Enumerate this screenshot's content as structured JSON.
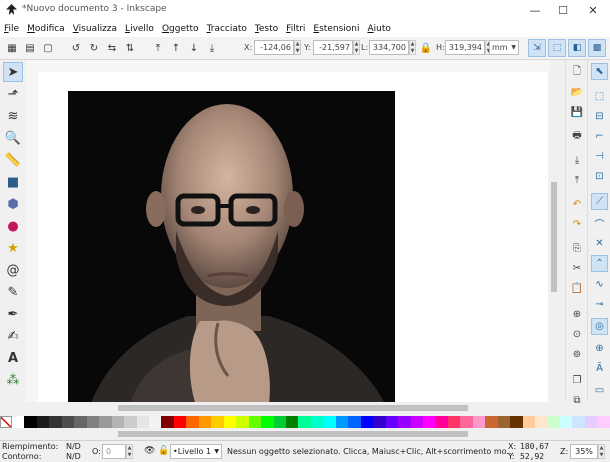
{
  "window": {
    "title": "*Nuovo documento 3 - Inkscape",
    "minimize": "—",
    "maximize": "☐",
    "close": "✕"
  },
  "menu": [
    "File",
    "Modifica",
    "Visualizza",
    "Livello",
    "Oggetto",
    "Tracciato",
    "Testo",
    "Filtri",
    "Estensioni",
    "Aiuto"
  ],
  "toolbar": {
    "x_label": "X:",
    "x_value": "-124,06",
    "y_label": "Y:",
    "y_value": "-21,597",
    "w_label": "L:",
    "w_value": "334,700",
    "h_label": "H:",
    "h_value": "319,394",
    "unit": "mm"
  },
  "status": {
    "fill_label": "Riempimento:",
    "fill_value": "N/D",
    "stroke_label": "Contorno:",
    "stroke_value": "N/D",
    "opacity_label": "O:",
    "opacity_value": "0",
    "layer": "•Livello 1",
    "message": "Nessun oggetto selezionato. Clicca, Maiusc+Clic, Alt+scorrimento mo...",
    "x_label": "X:",
    "x_value": "180,67",
    "y_label": "Y:",
    "y_value": "52,92",
    "z_label": "Z:",
    "zoom": "35%"
  },
  "palette": [
    "#ffffff",
    "#000000",
    "#1a1a1a",
    "#333333",
    "#4d4d4d",
    "#666666",
    "#808080",
    "#999999",
    "#b3b3b3",
    "#cccccc",
    "#e6e6e6",
    "#f2f2f2",
    "#800000",
    "#ff0000",
    "#ff6600",
    "#ff9900",
    "#ffcc00",
    "#ffff00",
    "#ccff00",
    "#66ff00",
    "#00ff00",
    "#00cc33",
    "#008000",
    "#00ff99",
    "#00ffcc",
    "#00ffff",
    "#0099ff",
    "#0066ff",
    "#0000ff",
    "#3300cc",
    "#6600ff",
    "#9900ff",
    "#cc00ff",
    "#ff00ff",
    "#ff0099",
    "#ff3366",
    "#ff6699",
    "#ff99cc",
    "#cc6633",
    "#996633",
    "#663300",
    "#ffcc99",
    "#ffe6cc",
    "#ccffcc",
    "#ccffff",
    "#cce6ff",
    "#e6ccff",
    "#ffccff"
  ]
}
